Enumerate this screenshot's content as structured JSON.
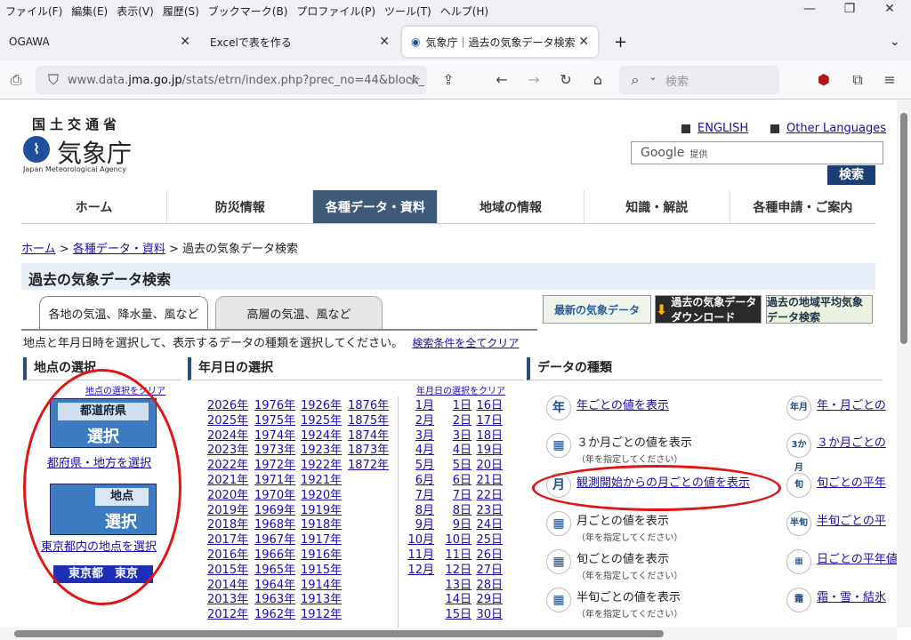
{
  "browser": {
    "menu": [
      "ファイル(F)",
      "編集(E)",
      "表示(V)",
      "履歴(S)",
      "ブックマーク(B)",
      "プロファイル(P)",
      "ツール(T)",
      "ヘルプ(H)"
    ],
    "tabs": [
      {
        "title": "OGAWA"
      },
      {
        "title": "Excelで表を作る"
      },
      {
        "title": "気象庁｜過去の気象データ検索"
      }
    ],
    "url_prefix": "www.data.",
    "url_domain": "jma.go.jp",
    "url_rest": "/stats/etrn/index.php?prec_no=44&block_",
    "search_placeholder": "検索"
  },
  "header": {
    "ministry": "国土交通省",
    "agency": "気象庁",
    "agency_en": "Japan Meteorological Agency",
    "english": "ENGLISH",
    "other_languages": "Other Languages",
    "google": "Google",
    "google_sub": "提供",
    "search_button": "検索"
  },
  "global_nav": [
    "ホーム",
    "防災情報",
    "各種データ・資料",
    "地域の情報",
    "知識・解説",
    "各種申請・ご案内"
  ],
  "breadcrumb": {
    "home": "ホーム",
    "sep": ">",
    "data": "各種データ・資料",
    "current": "過去の気象データ検索"
  },
  "page_title": "過去の気象データ検索",
  "tabs": [
    "各地の気温、降水量、風など",
    "高層の気温、風など"
  ],
  "banners": [
    "最新の気象データ",
    "過去の気象データ ダウンロード",
    "過去の地域平均気象データ検索"
  ],
  "instruction": "地点と年月日時を選択して、表示するデータの種類を選択してください。",
  "clear_all": "検索条件を全てクリア",
  "location": {
    "heading": "地点の選択",
    "clear": "地点の選択をクリア",
    "pref_img_top": "都道府県",
    "pref_img_bottom": "選択",
    "pref_link": "都府県・地方を選択",
    "point_img_top": "地点",
    "point_img_bottom": "選択",
    "point_link": "東京都内の地点を選択",
    "selected": "東京都　東京"
  },
  "date": {
    "heading": "年月日の選択",
    "clear": "年月日の選択をクリア",
    "years_col1": [
      "2026年",
      "2025年",
      "2024年",
      "2023年",
      "2022年",
      "2021年",
      "2020年",
      "2019年",
      "2018年",
      "2017年",
      "2016年",
      "2015年",
      "2014年",
      "2013年",
      "2012年"
    ],
    "years_col2": [
      "1976年",
      "1975年",
      "1974年",
      "1973年",
      "1972年",
      "1971年",
      "1970年",
      "1969年",
      "1968年",
      "1967年",
      "1966年",
      "1965年",
      "1964年",
      "1963年",
      "1962年"
    ],
    "years_col3": [
      "1926年",
      "1925年",
      "1924年",
      "1923年",
      "1922年",
      "1921年",
      "1920年",
      "1919年",
      "1918年",
      "1917年",
      "1916年",
      "1915年",
      "1914年",
      "1913年",
      "1912年"
    ],
    "years_col4": [
      "1876年",
      "1875年",
      "1874年",
      "1873年",
      "1872年"
    ],
    "months": [
      "1月",
      "2月",
      "3月",
      "4月",
      "5月",
      "6月",
      "7月",
      "8月",
      "9月",
      "10月",
      "11月",
      "12月"
    ],
    "days_col1": [
      "1日",
      "2日",
      "3日",
      "4日",
      "5日",
      "6日",
      "7日",
      "8日",
      "9日",
      "10日",
      "11日",
      "12日",
      "13日",
      "14日",
      "15日"
    ],
    "days_col2": [
      "16日",
      "17日",
      "18日",
      "19日",
      "20日",
      "21日",
      "22日",
      "23日",
      "24日",
      "25日",
      "26日",
      "27日",
      "28日",
      "29日",
      "30日"
    ]
  },
  "datatype": {
    "heading": "データの種類",
    "left": [
      {
        "icon": "年",
        "label": "年ごとの値を表示",
        "link": true,
        "sub": ""
      },
      {
        "icon": "▦",
        "label": "３か月ごとの値を表示",
        "link": false,
        "sub": "（年を指定してください）"
      },
      {
        "icon": "月",
        "label": "観測開始からの月ごとの値を表示",
        "link": true,
        "sub": ""
      },
      {
        "icon": "▦",
        "label": "月ごとの値を表示",
        "link": false,
        "sub": "（年を指定してください）"
      },
      {
        "icon": "▦",
        "label": "旬ごとの値を表示",
        "link": false,
        "sub": "（年を指定してください）"
      },
      {
        "icon": "▦",
        "label": "半旬ごとの値を表示",
        "link": false,
        "sub": "（年を指定してください）"
      }
    ],
    "right": [
      {
        "icon": "年月",
        "label": "年・月ごとの"
      },
      {
        "icon": "3か月",
        "label": "３か月ごとの"
      },
      {
        "icon": "旬",
        "label": "旬ごとの平年"
      },
      {
        "icon": "半旬",
        "label": "半旬ごとの平"
      },
      {
        "icon": "▦",
        "label": "日ごとの平年値"
      },
      {
        "icon": "霜",
        "label": "霜・雪・結氷"
      }
    ]
  }
}
